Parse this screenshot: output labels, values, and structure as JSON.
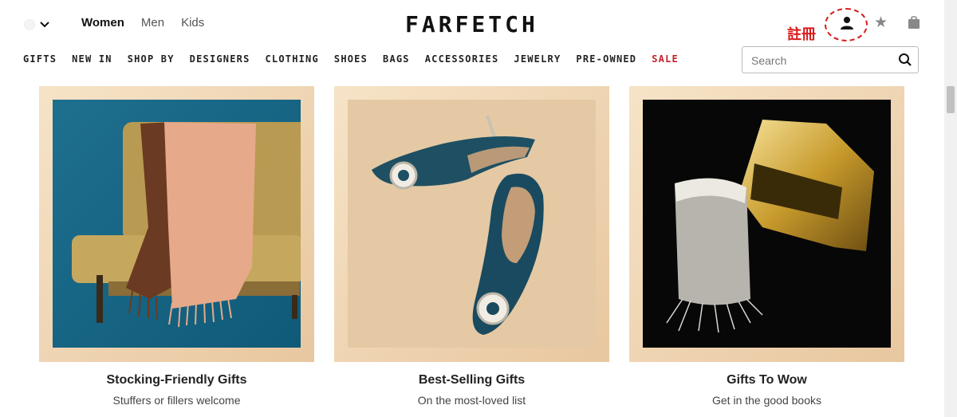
{
  "header": {
    "gender_tabs": [
      {
        "label": "Women",
        "active": true
      },
      {
        "label": "Men",
        "active": false
      },
      {
        "label": "Kids",
        "active": false
      }
    ],
    "logo": "FARFETCH",
    "annotation": "註冊",
    "icons": [
      "chevron-down-icon",
      "account-icon",
      "star-icon",
      "bag-icon",
      "search-icon"
    ]
  },
  "nav": {
    "items": [
      "GIFTS",
      "NEW IN",
      "SHOP BY",
      "DESIGNERS",
      "CLOTHING",
      "SHOES",
      "BAGS",
      "ACCESSORIES",
      "JEWELRY",
      "PRE-OWNED",
      "SALE"
    ]
  },
  "search": {
    "placeholder": "Search",
    "value": ""
  },
  "cards": [
    {
      "title": "Stocking-Friendly Gifts",
      "subtitle": "Stuffers or fillers welcome"
    },
    {
      "title": "Best-Selling Gifts",
      "subtitle": "On the most-loved list"
    },
    {
      "title": "Gifts To Wow",
      "subtitle": "Get in the good books"
    }
  ],
  "colors": {
    "accent_sale": "#c4222b",
    "annotation": "#d81c1c",
    "card_frame": "#e8c79f"
  }
}
